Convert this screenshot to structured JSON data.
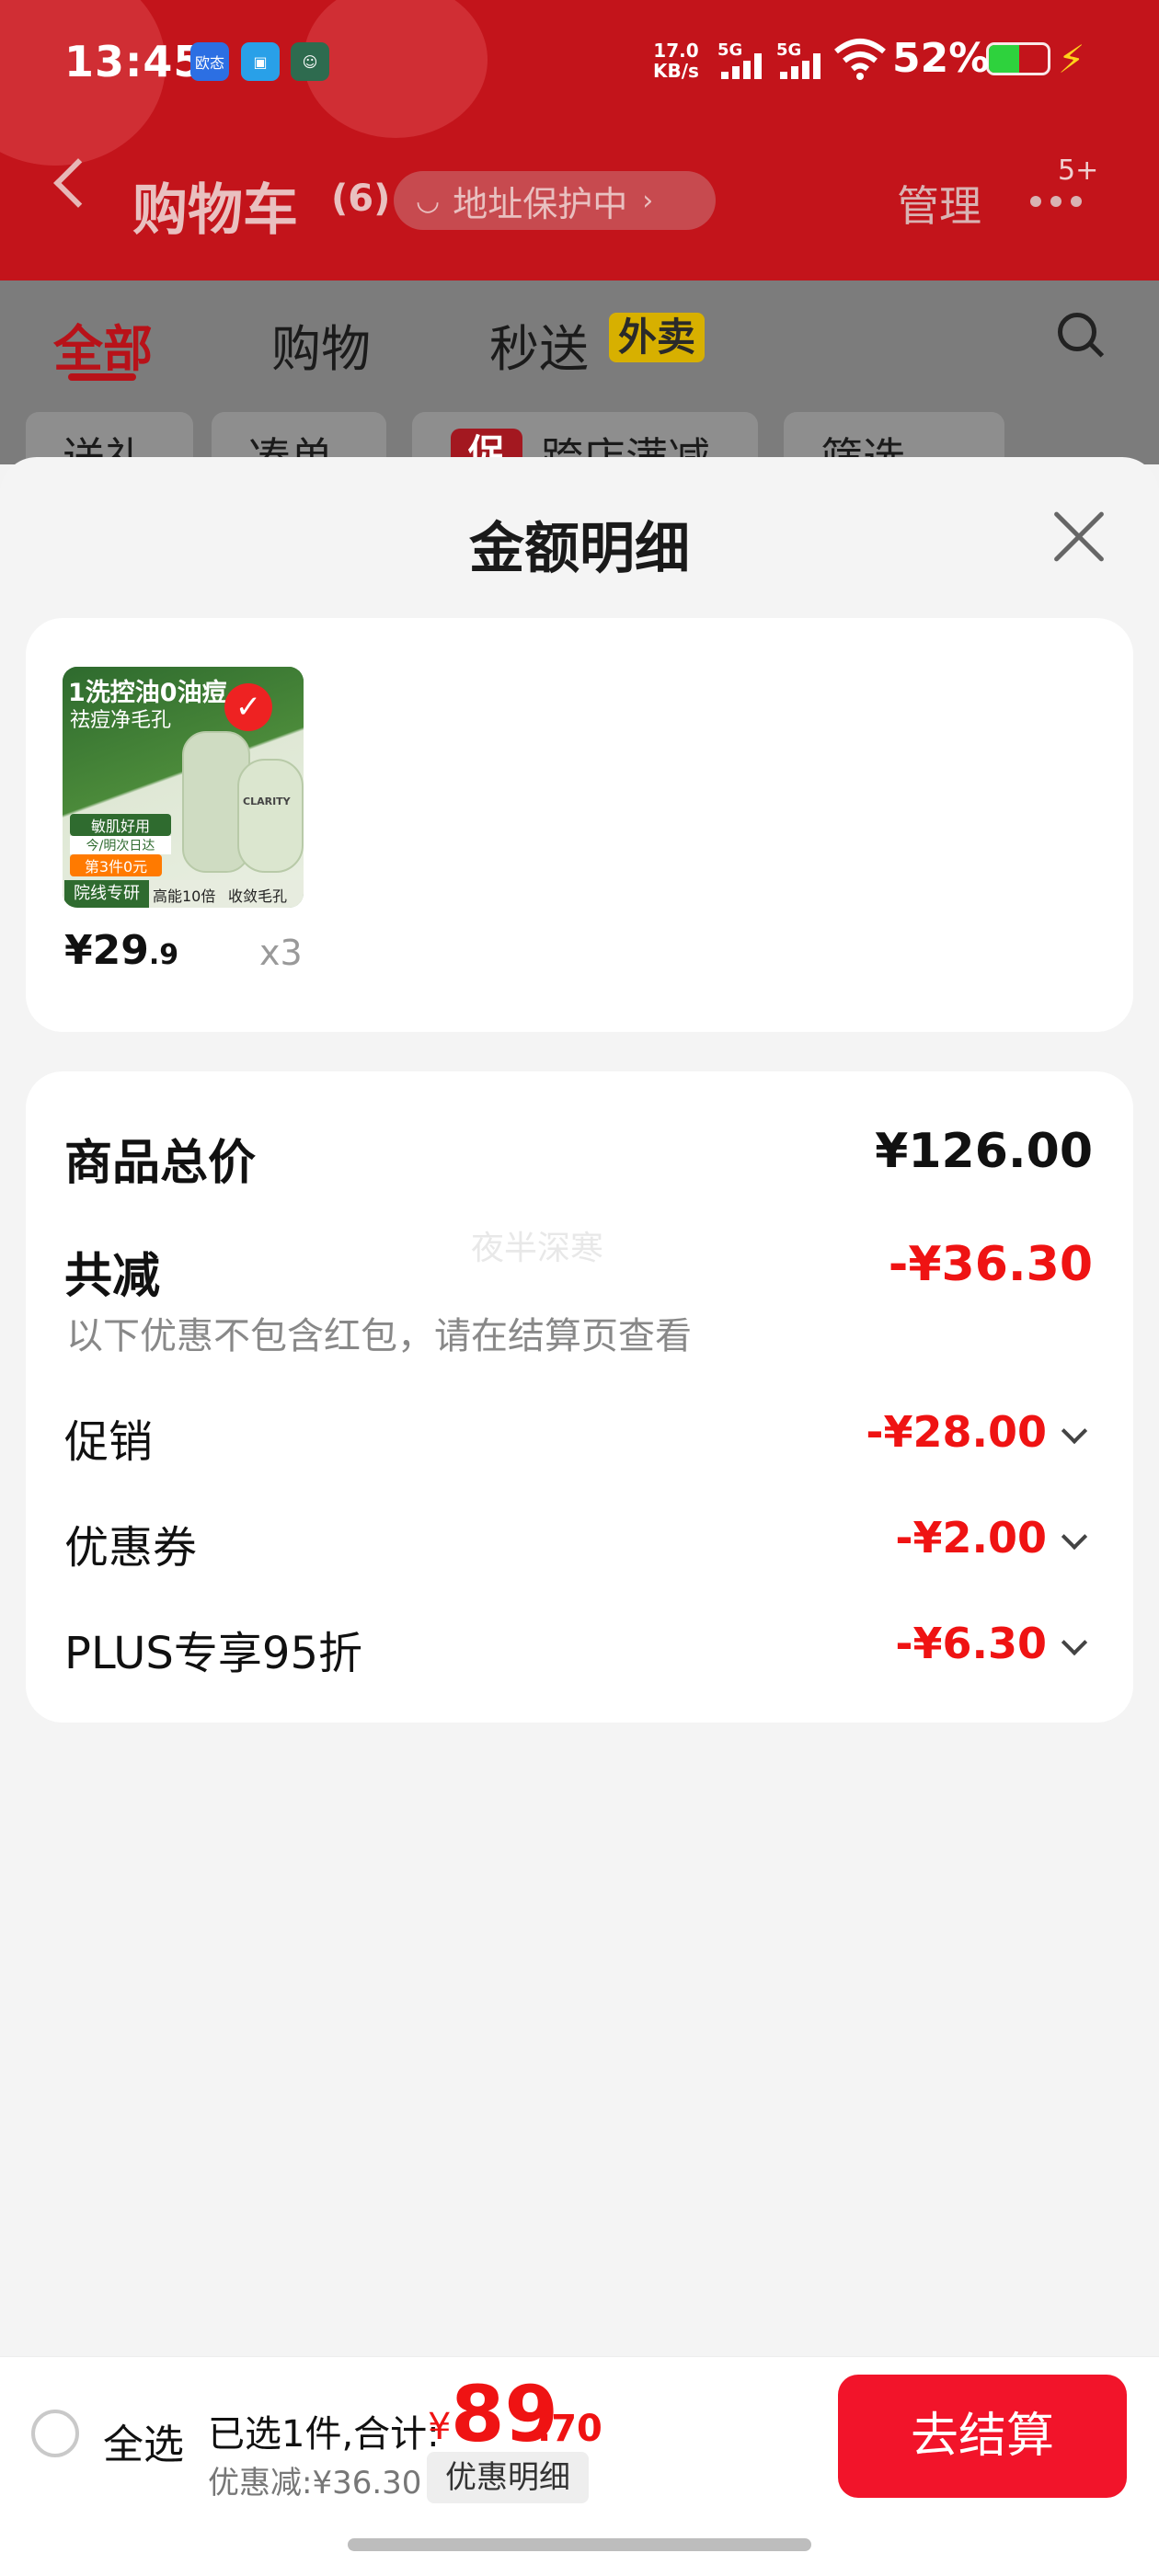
{
  "status_bar": {
    "time": "13:45",
    "app_icons": [
      "欧态",
      "clip-icon",
      "avatar-icon"
    ],
    "net_speed_value": "17.0",
    "net_speed_unit": "KB/s",
    "sim1": "5G",
    "sim2": "5G",
    "battery": "52%",
    "battery_level": 0.52
  },
  "nav": {
    "title": "购物车",
    "count": "(6)",
    "address_pill": "地址保护中",
    "manage": "管理",
    "badge": "5+"
  },
  "tabs": [
    {
      "label": "全部",
      "active": true
    },
    {
      "label": "购物",
      "active": false
    },
    {
      "label": "秒送",
      "active": false
    }
  ],
  "waimai_tag": "外卖",
  "chips": [
    "送礼",
    "凑单",
    "跨店满减",
    "筛选"
  ],
  "chip_promo_tag": "促",
  "sheet": {
    "title": "金额明细",
    "product": {
      "image_text": {
        "line1": "1洗控油0油痘",
        "line2": "祛痘净毛孔",
        "badge1": "敏肌好用",
        "badge2": "今/明次日达",
        "badge3": "第3件0元",
        "footer1": "院线专研",
        "footer2": "高能10倍",
        "footer3": "收敛毛孔",
        "brand": "CLARITY"
      },
      "price_main": "¥29",
      "price_dec": ".9",
      "qty": "x3"
    },
    "breakdown": {
      "total_label": "商品总价",
      "total_value": "¥126.00",
      "reduce_label": "共减",
      "reduce_value": "-¥36.30",
      "note": "以下优惠不包含红包，请在结算页查看",
      "watermark": "夜半深寒",
      "items": [
        {
          "label": "促销",
          "value": "-¥28.00"
        },
        {
          "label": "优惠券",
          "value": "-¥2.00"
        },
        {
          "label": "PLUS专享95折",
          "value": "-¥6.30"
        }
      ]
    }
  },
  "bottom_bar": {
    "select_all": "全选",
    "summary": "已选1件,合计:",
    "currency": "¥",
    "total_int": "89",
    "total_dec": ".70",
    "discount": "优惠减:¥36.30",
    "detail_button": "优惠明细",
    "checkout": "去结算"
  },
  "colors": {
    "brand_red": "#c3141b",
    "price_red": "#ef1313",
    "checkout_red": "#f2142a"
  }
}
